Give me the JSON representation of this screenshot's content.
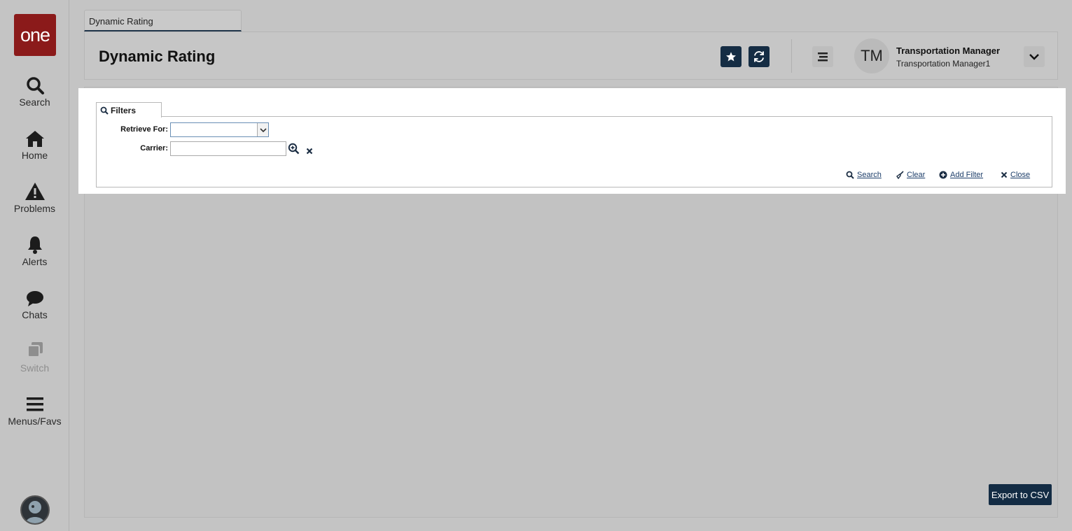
{
  "sidebar": {
    "logo_text": "one",
    "items": [
      {
        "label": "Search",
        "icon": "search-icon"
      },
      {
        "label": "Home",
        "icon": "home-icon"
      },
      {
        "label": "Problems",
        "icon": "warning-icon"
      },
      {
        "label": "Alerts",
        "icon": "bell-icon"
      },
      {
        "label": "Chats",
        "icon": "chat-icon"
      },
      {
        "label": "Switch",
        "icon": "switch-icon",
        "disabled": true
      },
      {
        "label": "Menus/Favs",
        "icon": "hamburger-icon"
      }
    ]
  },
  "tab": {
    "label": "Dynamic Rating"
  },
  "header": {
    "title": "Dynamic Rating",
    "user": {
      "initials": "TM",
      "name": "Transportation Manager",
      "role": "Transportation Manager1"
    }
  },
  "filters": {
    "tab_label": "Filters",
    "fields": {
      "retrieve_for": {
        "label": "Retrieve For:",
        "value": ""
      },
      "carrier": {
        "label": "Carrier:",
        "value": ""
      }
    },
    "actions": {
      "search": "Search",
      "clear": "Clear",
      "add_filter": "Add Filter",
      "close": "Close"
    }
  },
  "export_label": "Export to CSV",
  "colors": {
    "brand": "#8b1a1a",
    "primary_button": "#152d44",
    "link": "#1d3e6a"
  }
}
